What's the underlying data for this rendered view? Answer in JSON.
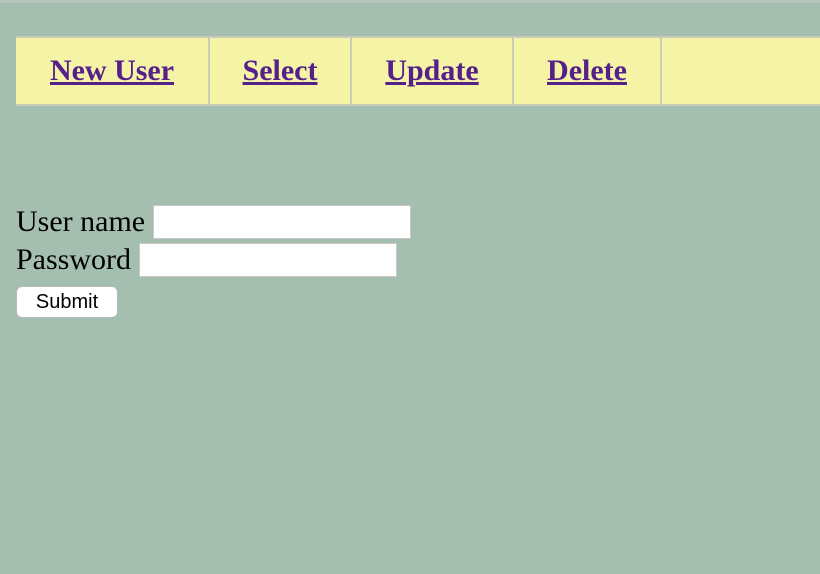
{
  "nav": {
    "items": [
      {
        "label": "New User"
      },
      {
        "label": "Select"
      },
      {
        "label": "Update"
      },
      {
        "label": "Delete"
      }
    ],
    "link_color": "#55208a",
    "background": "#f5f3a6"
  },
  "form": {
    "username_label": "User name",
    "username_value": "",
    "password_label": "Password",
    "password_value": "",
    "submit_label": "Submit"
  },
  "colors": {
    "page_background": "#a4bfaf"
  }
}
